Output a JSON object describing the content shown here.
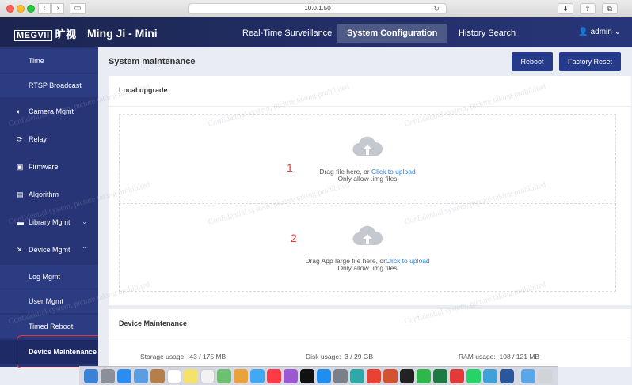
{
  "browser": {
    "url": "10.0.1.50"
  },
  "header": {
    "logo_text": "MEGVII",
    "logo_cn": "旷视",
    "app_title": "Ming Ji - Mini",
    "tabs": [
      {
        "label": "Real-Time Surveillance"
      },
      {
        "label": "System Configuration"
      },
      {
        "label": "History Search"
      }
    ],
    "user": "admin"
  },
  "sidebar": {
    "items": [
      {
        "label": "Time"
      },
      {
        "label": "RTSP Broadcast"
      },
      {
        "label": "Camera Mgmt"
      },
      {
        "label": "Relay"
      },
      {
        "label": "Firmware"
      },
      {
        "label": "Algorithm"
      },
      {
        "label": "Library Mgmt"
      },
      {
        "label": "Device Mgmt"
      },
      {
        "label": "Log Mgmt"
      },
      {
        "label": "User Mgmt"
      },
      {
        "label": "Timed Reboot"
      },
      {
        "label": "Device Maintenance"
      }
    ]
  },
  "main": {
    "title": "System maintenance",
    "reboot_label": "Reboot",
    "factory_reset_label": "Factory Reset",
    "local_upgrade": {
      "title": "Local upgrade",
      "zone1": {
        "marker": "1",
        "text": "Drag file here, or ",
        "link": "Click to upload",
        "hint": "Only allow .img files"
      },
      "zone2": {
        "marker": "2",
        "text": "Drag App large file here, or",
        "link": "Click to upload",
        "hint": "Only allow .img files"
      }
    },
    "device_maintenance": {
      "title": "Device Maintenance",
      "storage_label": "Storage usage:",
      "storage_value": "43 / 175 MB",
      "disk_label": "Disk usage:",
      "disk_value": "3 / 29 GB",
      "ram_label": "RAM usage:",
      "ram_value": "108 / 121 MB"
    }
  },
  "watermark": "Confidential system, picture taking prohibited",
  "colors": {
    "header": "#273679",
    "sidebar": "#273577",
    "button": "#253a8a",
    "link": "#2f86e0",
    "annotation": "#e53935"
  }
}
